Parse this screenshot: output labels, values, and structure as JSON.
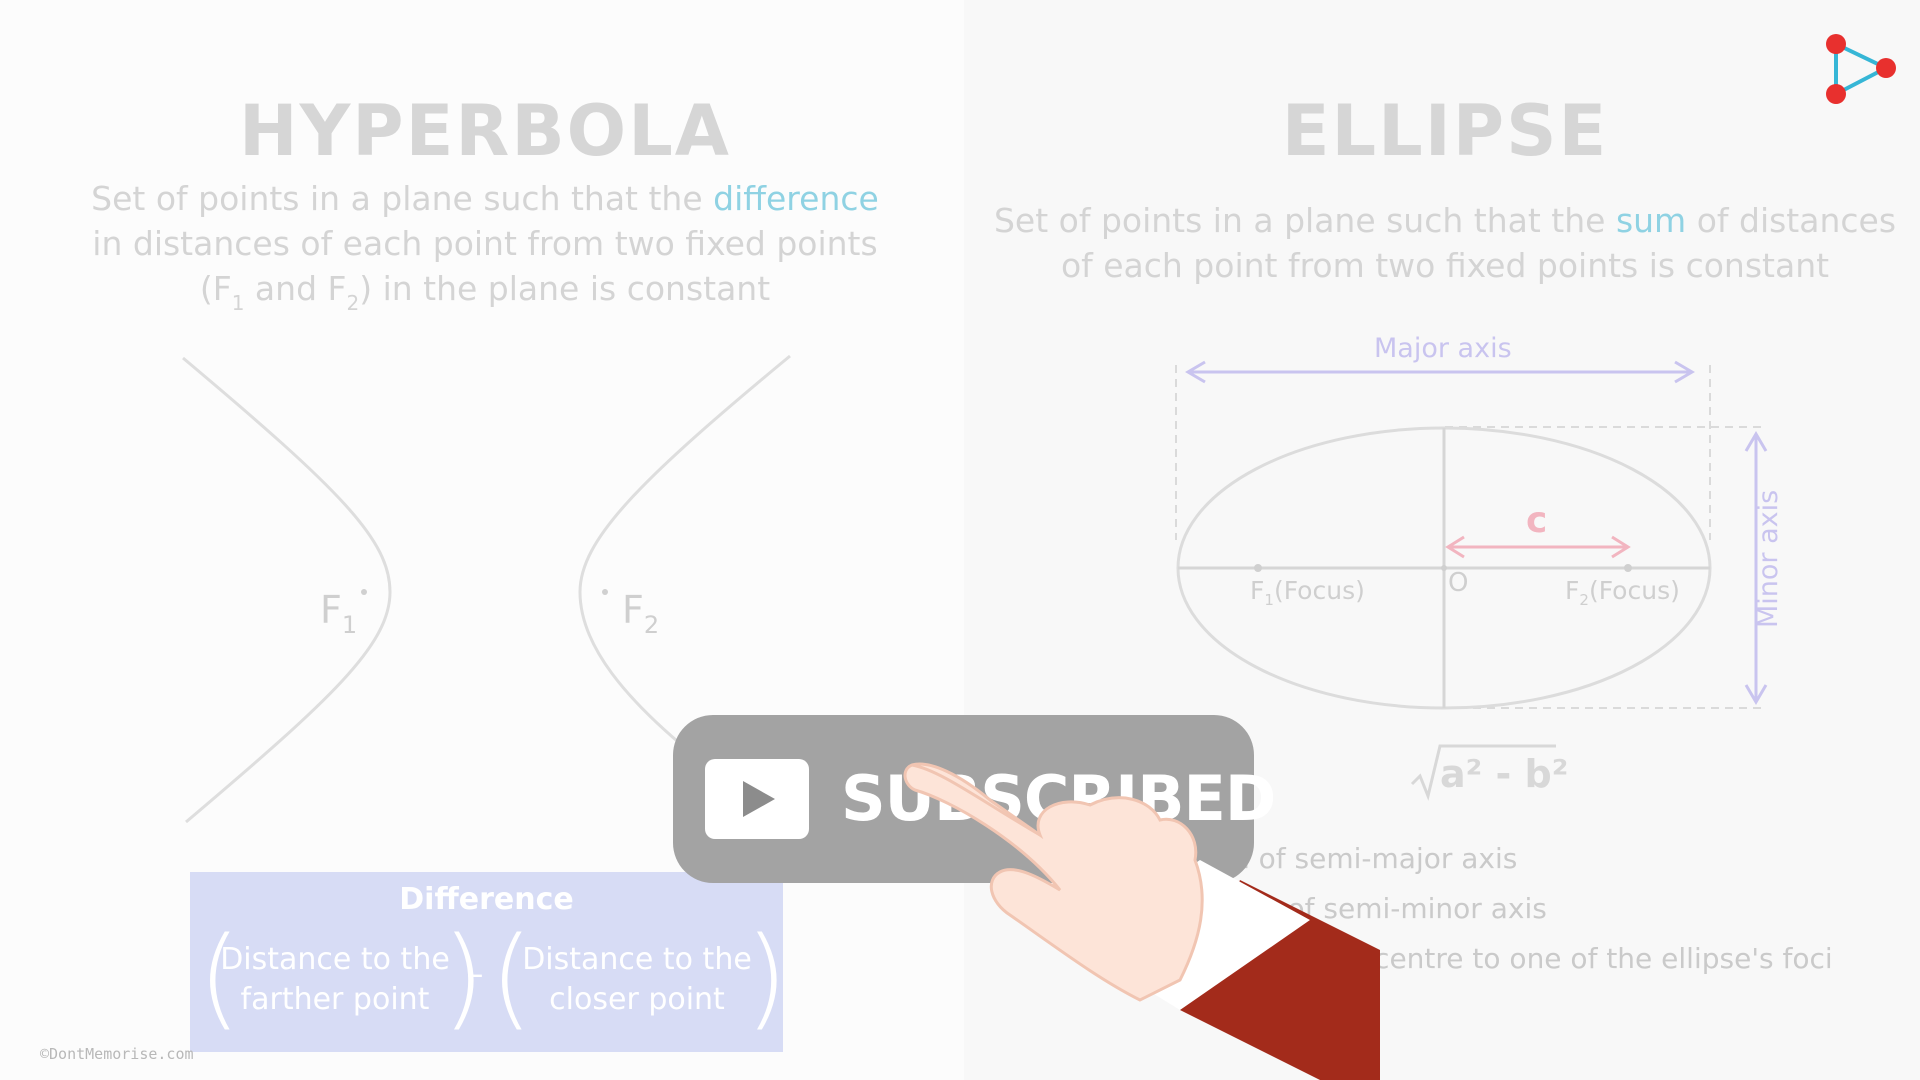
{
  "hyperbola": {
    "title": "HYPERBOLA",
    "desc_before": "Set of points in a plane such that the ",
    "desc_highlight": "difference",
    "desc_line2": "in distances of each point from two fixed points",
    "desc_line3_a": "(F",
    "desc_line3_sub1": "1",
    "desc_line3_b": " and F",
    "desc_line3_sub2": "2",
    "desc_line3_c": ") in the plane is constant",
    "focus1": "F",
    "focus1_sub": "1",
    "focus2": "F",
    "focus2_sub": "2",
    "highlight_color": "#8fd2e3"
  },
  "difference_box": {
    "title": "Difference",
    "term1": "Distance to the farther point",
    "minus": "–",
    "term2": "Distance to the closer point",
    "box_color": "#d7dcf5"
  },
  "ellipse": {
    "title": "ELLIPSE",
    "desc_before": "Set of points in a plane such that the ",
    "desc_highlight": "sum",
    "desc_after": " of distances",
    "desc_line2": "of each point from two fixed points is constant",
    "major_axis": "Major axis",
    "minor_axis": "Minor axis",
    "c_label": "c",
    "origin": "O",
    "focus1": "F",
    "focus1_sub": "1",
    "focus1_note": "(Focus)",
    "focus2": "F",
    "focus2_sub": "2",
    "focus2_note": "(Focus)",
    "formula": "a² - b²",
    "legend": [
      "n of semi-major axis",
      "= length of semi-minor axis",
      "stance from centre to one of the ellipse's foci"
    ],
    "axis_color": "#c9c4ef",
    "c_color": "#f2b5c0"
  },
  "overlay": {
    "subscribe_label": "SUBSCRIBED"
  },
  "footer": {
    "copyright": "©DontMemorise.com"
  },
  "brand": {
    "logo_color": "#e8302e",
    "logo_line_color": "#36b6d6"
  }
}
